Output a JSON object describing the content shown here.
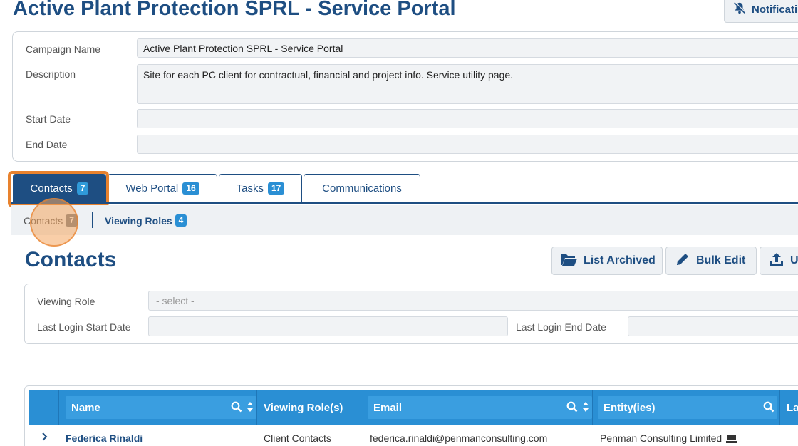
{
  "page": {
    "title": "Active Plant Protection SPRL - Service Portal",
    "notifications_label": "Notificati"
  },
  "campaign": {
    "name_label": "Campaign Name",
    "name_value": "Active Plant Protection SPRL - Service Portal",
    "description_label": "Description",
    "description_value": "Site for each PC client for contractual, financial and project info. Service utility page.",
    "start_label": "Start Date",
    "start_value": "",
    "end_label": "End Date",
    "end_value": ""
  },
  "tabs": [
    {
      "label": "Contacts",
      "count": "7",
      "active": true
    },
    {
      "label": "Web Portal",
      "count": "16",
      "active": false
    },
    {
      "label": "Tasks",
      "count": "17",
      "active": false
    },
    {
      "label": "Communications",
      "count": "",
      "active": false
    }
  ],
  "subnav": [
    {
      "label": "Contacts",
      "count": "7"
    },
    {
      "label": "Viewing Roles",
      "count": "4"
    }
  ],
  "section": {
    "title": "Contacts",
    "buttons": {
      "list_archived": "List Archived",
      "bulk_edit": "Bulk Edit",
      "upload": "U"
    }
  },
  "filters": {
    "viewing_role_label": "Viewing Role",
    "viewing_role_placeholder": "- select -",
    "login_start_label": "Last Login Start Date",
    "login_end_label": "Last Login End Date"
  },
  "table": {
    "columns": [
      "Name",
      "Viewing Role(s)",
      "Email",
      "Entity(ies)",
      "La"
    ],
    "rows": [
      {
        "name": "Federica Rinaldi",
        "role": "Client Contacts",
        "email": "federica.rinaldi@penmanconsulting.com",
        "entity": "Penman Consulting Limited"
      }
    ]
  },
  "colors": {
    "primary": "#1e4e82",
    "accent": "#2a8fd4",
    "highlight": "#e8822e"
  },
  "icons": [
    "bell-slash-icon",
    "folder-open-icon",
    "pencil-icon",
    "upload-icon",
    "search-icon",
    "sort-icon",
    "chevron-right-icon",
    "laptop-icon"
  ]
}
